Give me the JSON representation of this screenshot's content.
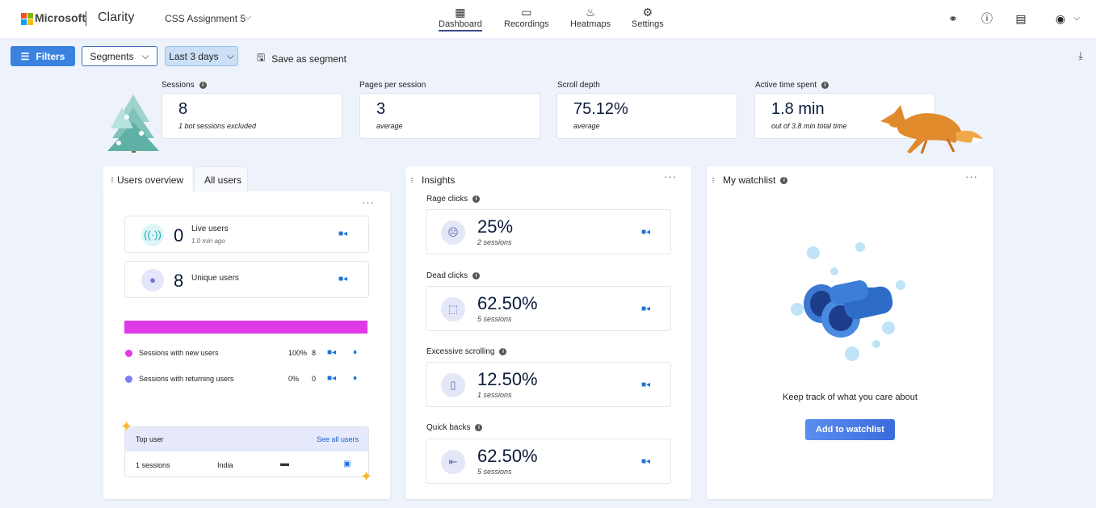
{
  "header": {
    "brand": "Microsoft",
    "product": "Clarity",
    "project": "CSS Assignment 5",
    "nav": [
      {
        "label": "Dashboard",
        "icon": "dashboard-icon"
      },
      {
        "label": "Recordings",
        "icon": "video-icon"
      },
      {
        "label": "Heatmaps",
        "icon": "flame-icon"
      },
      {
        "label": "Settings",
        "icon": "gear-icon"
      }
    ]
  },
  "toolbar": {
    "filters": "Filters",
    "segments": "Segments",
    "date_range": "Last 3 days",
    "save_segment": "Save as segment"
  },
  "metrics": [
    {
      "label": "Sessions",
      "value": "8",
      "sub": "1 bot sessions excluded"
    },
    {
      "label": "Pages per session",
      "value": "3",
      "sub": "average"
    },
    {
      "label": "Scroll depth",
      "value": "75.12%",
      "sub": "average"
    },
    {
      "label": "Active time spent",
      "value": "1.8 min",
      "sub": "out of 3.8 min total time"
    }
  ],
  "users_panel": {
    "tab_active": "Users overview",
    "tab_other": "All users",
    "live": {
      "value": "0",
      "label": "Live users",
      "sub": "1.0 min ago"
    },
    "unique": {
      "value": "8",
      "label": "Unique users"
    },
    "new_users": {
      "label": "Sessions with new users",
      "pct": "100%",
      "count": "8",
      "color": "#e03ae8"
    },
    "returning_users": {
      "label": "Sessions with returning users",
      "pct": "0%",
      "count": "0",
      "color": "#7b7ff0"
    },
    "top_user": {
      "title": "Top user",
      "link": "See all users",
      "sessions": "1 sessions",
      "country": "India"
    }
  },
  "insights": {
    "title": "Insights",
    "items": [
      {
        "label": "Rage clicks",
        "value": "25%",
        "sub": "2 sessions"
      },
      {
        "label": "Dead clicks",
        "value": "62.50%",
        "sub": "5 sessions"
      },
      {
        "label": "Excessive scrolling",
        "value": "12.50%",
        "sub": "1 sessions"
      },
      {
        "label": "Quick backs",
        "value": "62.50%",
        "sub": "5 sessions"
      }
    ]
  },
  "watchlist": {
    "title": "My watchlist",
    "message": "Keep track of what you care about",
    "button": "Add to watchlist"
  }
}
